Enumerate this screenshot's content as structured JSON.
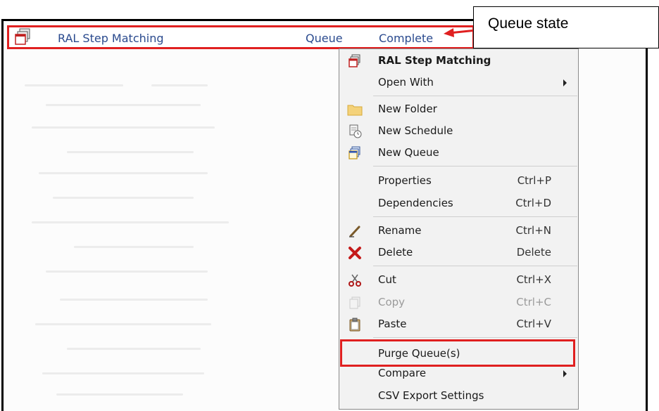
{
  "row": {
    "name": "RAL Step Matching",
    "type": "Queue",
    "state": "Complete"
  },
  "callout": {
    "text": "Queue state"
  },
  "menu": {
    "items": [
      {
        "label": "RAL Step Matching",
        "shortcut": "",
        "icon": "queue-icon"
      },
      {
        "label": "Open With",
        "shortcut": "",
        "icon": ""
      },
      {
        "label": "New Folder",
        "shortcut": "",
        "icon": "folder-icon"
      },
      {
        "label": "New Schedule",
        "shortcut": "",
        "icon": "schedule-icon"
      },
      {
        "label": "New Queue",
        "shortcut": "",
        "icon": "new-queue-icon"
      },
      {
        "label": "Properties",
        "shortcut": "Ctrl+P",
        "icon": ""
      },
      {
        "label": "Dependencies",
        "shortcut": "Ctrl+D",
        "icon": ""
      },
      {
        "label": "Rename",
        "shortcut": "Ctrl+N",
        "icon": "pencil-icon"
      },
      {
        "label": "Delete",
        "shortcut": "Delete",
        "icon": "delete-x-icon"
      },
      {
        "label": "Cut",
        "shortcut": "Ctrl+X",
        "icon": "scissors-icon"
      },
      {
        "label": "Copy",
        "shortcut": "Ctrl+C",
        "icon": "copy-icon"
      },
      {
        "label": "Paste",
        "shortcut": "Ctrl+V",
        "icon": "clipboard-icon"
      },
      {
        "label": "Purge Queue(s)",
        "shortcut": "",
        "icon": ""
      },
      {
        "label": "Compare",
        "shortcut": "",
        "icon": ""
      },
      {
        "label": "CSV Export Settings",
        "shortcut": "",
        "icon": ""
      }
    ]
  },
  "colors": {
    "highlight": "#e02020",
    "link_text": "#2a4a8e"
  }
}
